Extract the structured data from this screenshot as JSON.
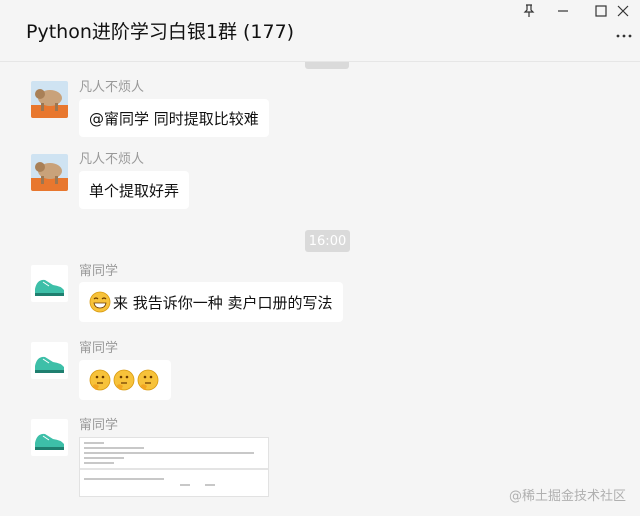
{
  "window": {
    "title": "Python进阶学习白银1群 (177)",
    "icons": [
      "pin-icon",
      "minimize-icon",
      "maximize-icon",
      "close-icon",
      "more-icon"
    ]
  },
  "messages": [
    {
      "sender": "凡人不烦人",
      "text": "@甯同学 同时提取比较难",
      "avatar": "dog-avatar"
    },
    {
      "sender": "凡人不烦人",
      "text": "单个提取好弄",
      "avatar": "dog-avatar"
    },
    {
      "sender": "甯同学",
      "text": "来 我告诉你一种 卖户口册的写法",
      "emoji": "grin-emoji",
      "avatar": "shoe-avatar"
    },
    {
      "sender": "甯同学",
      "emojis": [
        "thinking-emoji",
        "thinking-emoji",
        "thinking-emoji"
      ],
      "avatar": "shoe-avatar"
    },
    {
      "sender": "甯同学",
      "attachment": "code-screenshot",
      "avatar": "shoe-avatar"
    }
  ],
  "time_divider": "16:00",
  "watermark": "@稀土掘金技术社区"
}
